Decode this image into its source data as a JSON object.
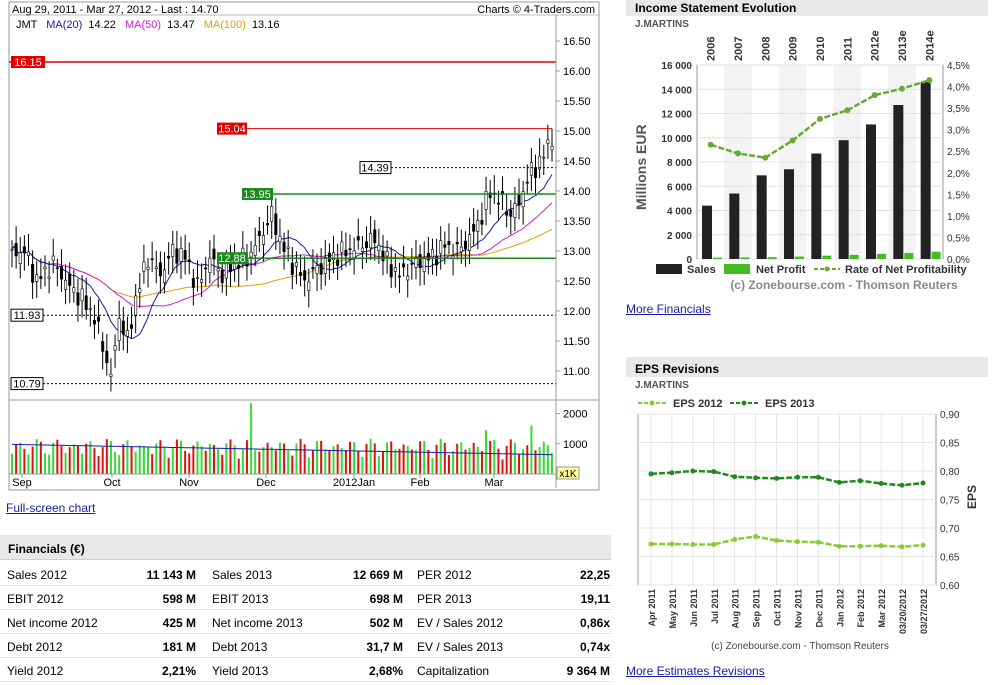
{
  "stock_chart": {
    "header": "Aug 29, 2011 - Mar 27, 2012 - Last : 14.70",
    "credit": "Charts © 4-Traders.com",
    "ticker": "JMT",
    "ma20_label": "MA(20)",
    "ma20_value": "14.22",
    "ma50_label": "MA(50)",
    "ma50_value": "13.47",
    "ma100_label": "MA(100)",
    "ma100_value": "13.16",
    "price_ticks": [
      "16.50",
      "16.00",
      "15.50",
      "15.00",
      "14.50",
      "14.00",
      "13.50",
      "13.00",
      "12.50",
      "12.00",
      "11.50",
      "11.00"
    ],
    "price_tick_values": [
      16.5,
      16.0,
      15.5,
      15.0,
      14.5,
      14.0,
      13.5,
      13.0,
      12.5,
      12.0,
      11.5,
      11.0
    ],
    "levels": [
      {
        "label": "16.15",
        "value": 16.15,
        "style": "red-left"
      },
      {
        "label": "15.04",
        "value": 15.04,
        "style": "red-mid"
      },
      {
        "label": "14.39",
        "value": 14.39,
        "style": "dashed-box"
      },
      {
        "label": "13.95",
        "value": 13.95,
        "style": "green"
      },
      {
        "label": "12.88",
        "value": 12.88,
        "style": "green"
      },
      {
        "label": "11.93",
        "value": 11.93,
        "style": "dashed-left"
      },
      {
        "label": "10.79",
        "value": 10.79,
        "style": "dashed-left"
      }
    ],
    "volume_ticks": [
      "2000",
      "1000"
    ],
    "volume_tick_values": [
      2000,
      1000
    ],
    "volume_unit": "x1K",
    "months": [
      "Sep",
      "Oct",
      "Nov",
      "Dec",
      "2012Jan",
      "Feb",
      "Mar"
    ],
    "colors": {
      "red": "#e00000",
      "green": "#1a8a1a",
      "ma20": "#1a1aa6",
      "ma50": "#cc22cc",
      "ma100": "#e0a000",
      "vol_up": "#33dd33",
      "vol_down": "#dd1111",
      "vol_avg": "#1a1aa6"
    }
  },
  "income_chart": {
    "title": "Income Statement Evolution",
    "company": "J.MARTINS",
    "years": [
      "2006",
      "2007",
      "2008",
      "2009",
      "2010",
      "2011",
      "2012e",
      "2013e",
      "2014e"
    ],
    "y_ticks": [
      "16 000",
      "14 000",
      "12 000",
      "10 000",
      "8 000",
      "6 000",
      "4 000",
      "2 000",
      "0"
    ],
    "y_tick_values": [
      16000,
      14000,
      12000,
      10000,
      8000,
      6000,
      4000,
      2000,
      0
    ],
    "y2_ticks": [
      "4,5%",
      "4,0%",
      "3,5%",
      "3,0%",
      "2,5%",
      "2,0%",
      "1,5%",
      "1,0%",
      "0,5%",
      "0,0%"
    ],
    "y2_tick_values": [
      4.5,
      4.0,
      3.5,
      3.0,
      2.5,
      2.0,
      1.5,
      1.0,
      0.5,
      0.0
    ],
    "ylabel": "Millions EUR",
    "legend": [
      "Sales",
      "Net Profit",
      "Rate of Net Profitability"
    ],
    "credit": "(c) Zonebourse.com - Thomson Reuters",
    "colors": {
      "sales": "#222222",
      "net_profit": "#44bb22",
      "rate": "#66aa33"
    }
  },
  "more_financials": "More Financials",
  "eps_chart": {
    "title": "EPS Revisions",
    "company": "J.MARTINS",
    "legend": [
      "EPS 2012",
      "EPS 2013"
    ],
    "y_ticks": [
      "0,90",
      "0,85",
      "0,80",
      "0,75",
      "0,70",
      "0,65",
      "0,60"
    ],
    "y_tick_values": [
      0.9,
      0.85,
      0.8,
      0.75,
      0.7,
      0.65,
      0.6
    ],
    "ylabel": "EPS",
    "x_labels": [
      "Apr 2011",
      "May 2011",
      "Jun 2011",
      "Jul 2011",
      "Aug 2011",
      "Sep 2011",
      "Oct 2011",
      "Nov 2011",
      "Dec 2011",
      "Jan 2012",
      "Feb 2012",
      "Mar 2012",
      "03/20/2012",
      "03/27/2012"
    ],
    "credit": "(c) Zonebourse.com - Thomson Reuters",
    "colors": {
      "eps2012": "#88cc33",
      "eps2013": "#228822"
    }
  },
  "more_estimates": "More Estimates Revisions",
  "fullscreen_link": "Full-screen chart",
  "financials": {
    "title": "Financials (€)",
    "rows": [
      [
        {
          "label": "Sales 2012",
          "value": "11 143 M"
        },
        {
          "label": "Sales 2013",
          "value": "12 669 M"
        },
        {
          "label": "PER 2012",
          "value": "22,25"
        }
      ],
      [
        {
          "label": "EBIT 2012",
          "value": "598 M"
        },
        {
          "label": "EBIT 2013",
          "value": "698 M"
        },
        {
          "label": "PER 2013",
          "value": "19,11"
        }
      ],
      [
        {
          "label": "Net income 2012",
          "value": "425 M"
        },
        {
          "label": "Net income 2013",
          "value": "502 M"
        },
        {
          "label": "EV / Sales 2012",
          "value": "0,86x"
        }
      ],
      [
        {
          "label": "Debt 2012",
          "value": "181 M"
        },
        {
          "label": "Debt 2013",
          "value": "31,7 M"
        },
        {
          "label": "EV / Sales 2013",
          "value": "0,74x"
        }
      ],
      [
        {
          "label": "Yield 2012",
          "value": "2,21%"
        },
        {
          "label": "Yield 2013",
          "value": "2,68%"
        },
        {
          "label": "Capitalization",
          "value": "9 364 M"
        }
      ]
    ]
  },
  "chart_data": [
    {
      "type": "bar",
      "title": "Income Statement Evolution",
      "ylabel": "Millions EUR",
      "categories": [
        "2006",
        "2007",
        "2008",
        "2009",
        "2010",
        "2011",
        "2012e",
        "2013e",
        "2014e"
      ],
      "ylim": [
        0,
        16000
      ],
      "series": [
        {
          "name": "Sales",
          "values": [
            4400,
            5400,
            6900,
            7400,
            8700,
            9800,
            11100,
            12700,
            14600
          ]
        },
        {
          "name": "Net Profit",
          "values": [
            110,
            130,
            150,
            200,
            280,
            340,
            425,
            500,
            600
          ]
        },
        {
          "name": "Rate of Net Profitability",
          "axis": "right",
          "ylim": [
            0,
            4.5
          ],
          "values": [
            2.65,
            2.45,
            2.35,
            2.75,
            3.25,
            3.45,
            3.8,
            3.95,
            4.15
          ]
        }
      ]
    },
    {
      "type": "line",
      "title": "EPS Revisions",
      "ylabel": "EPS",
      "categories": [
        "Apr 2011",
        "May 2011",
        "Jun 2011",
        "Jul 2011",
        "Aug 2011",
        "Sep 2011",
        "Oct 2011",
        "Nov 2011",
        "Dec 2011",
        "Jan 2012",
        "Feb 2012",
        "Mar 2012",
        "03/20/2012",
        "03/27/2012"
      ],
      "ylim": [
        0.6,
        0.9
      ],
      "series": [
        {
          "name": "EPS 2012",
          "values": [
            0.672,
            0.672,
            0.671,
            0.671,
            0.68,
            0.685,
            0.678,
            0.676,
            0.675,
            0.668,
            0.668,
            0.669,
            0.667,
            0.67
          ]
        },
        {
          "name": "EPS 2013",
          "values": [
            0.795,
            0.797,
            0.8,
            0.799,
            0.79,
            0.788,
            0.787,
            0.789,
            0.789,
            0.78,
            0.783,
            0.778,
            0.775,
            0.779
          ]
        }
      ]
    },
    {
      "type": "line",
      "title": "",
      "x": [
        "Aug 29, 2011",
        "Sep",
        "Oct",
        "Nov",
        "Dec",
        "2012Jan",
        "Feb",
        "Mar",
        "Mar 27, 2012"
      ],
      "ylim": [
        10.6,
        16.7
      ],
      "series": [
        {
          "name": "JMT",
          "values": [
            12.95,
            12.5,
            11.4,
            13.0,
            12.9,
            12.7,
            12.9,
            13.3,
            14.7
          ]
        },
        {
          "name": "MA(20)",
          "values": [
            12.9,
            12.7,
            11.8,
            12.8,
            13.0,
            12.8,
            12.9,
            13.2,
            14.22
          ]
        },
        {
          "name": "MA(50)",
          "values": [
            13.4,
            13.0,
            12.3,
            12.6,
            12.9,
            12.85,
            12.85,
            13.0,
            13.47
          ]
        },
        {
          "name": "MA(100)",
          "values": [
            13.3,
            13.2,
            12.9,
            12.75,
            12.8,
            12.8,
            12.8,
            12.9,
            13.16
          ]
        }
      ]
    }
  ]
}
